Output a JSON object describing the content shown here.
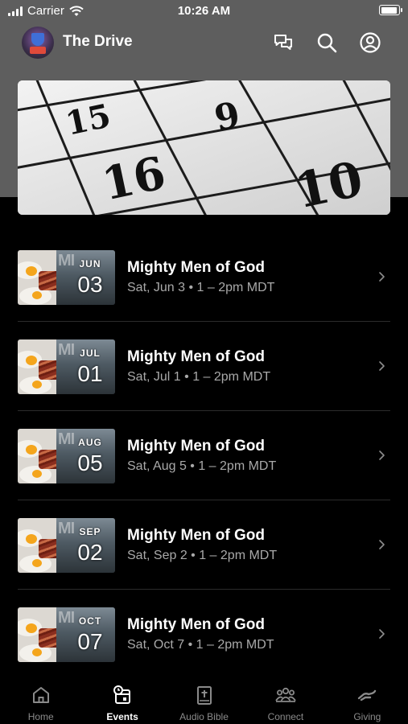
{
  "status_bar": {
    "carrier": "Carrier",
    "time": "10:26 AM",
    "battery_level": 0.95
  },
  "header": {
    "title": "The Drive"
  },
  "hero": {
    "calendar_numbers": [
      "15",
      "9",
      "16",
      "10"
    ]
  },
  "events": [
    {
      "month": "JUN",
      "day": "03",
      "title": "Mighty Men of God",
      "meta": "Sat, Jun 3 • 1 – 2pm MDT"
    },
    {
      "month": "JUL",
      "day": "01",
      "title": "Mighty Men of God",
      "meta": "Sat, Jul 1 • 1 – 2pm MDT"
    },
    {
      "month": "AUG",
      "day": "05",
      "title": "Mighty Men of God",
      "meta": "Sat, Aug 5 • 1 – 2pm MDT"
    },
    {
      "month": "SEP",
      "day": "02",
      "title": "Mighty Men of God",
      "meta": "Sat, Sep 2 • 1 – 2pm MDT"
    },
    {
      "month": "OCT",
      "day": "07",
      "title": "Mighty Men of God",
      "meta": "Sat, Oct 7 • 1 – 2pm MDT"
    }
  ],
  "tabs": [
    {
      "label": "Home",
      "icon": "home-icon",
      "active": false
    },
    {
      "label": "Events",
      "icon": "calendar-clock-icon",
      "active": true
    },
    {
      "label": "Audio Bible",
      "icon": "bible-icon",
      "active": false
    },
    {
      "label": "Connect",
      "icon": "group-icon",
      "active": false
    },
    {
      "label": "Giving",
      "icon": "giving-hand-icon",
      "active": false
    }
  ],
  "colors": {
    "background": "#000000",
    "header_band": "#5e5e5e",
    "muted_text": "#a9a9a9",
    "tab_inactive": "#8a8a8a"
  }
}
